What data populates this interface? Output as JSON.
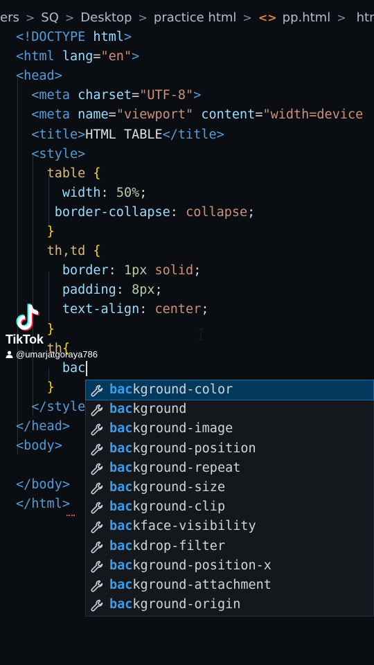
{
  "breadcrumb": {
    "items": [
      "ers",
      "SQ",
      "Desktop",
      "practice html",
      "pp.html",
      "html"
    ],
    "separator": ">"
  },
  "code_lines": [
    [
      {
        "t": "<!DOCTYPE ",
        "c": "tag"
      },
      {
        "t": "html",
        "c": "attr"
      },
      {
        "t": ">",
        "c": "tag"
      }
    ],
    [
      {
        "t": "<html ",
        "c": "tag"
      },
      {
        "t": "lang",
        "c": "attr"
      },
      {
        "t": "=",
        "c": "plain"
      },
      {
        "t": "\"en\"",
        "c": "str"
      },
      {
        "t": ">",
        "c": "tag"
      }
    ],
    [
      {
        "t": "<head>",
        "c": "tag"
      }
    ],
    [
      {
        "t": "  "
      },
      {
        "t": "<meta ",
        "c": "tag"
      },
      {
        "t": "charset",
        "c": "attr"
      },
      {
        "t": "=",
        "c": "plain"
      },
      {
        "t": "\"UTF-8\"",
        "c": "str"
      },
      {
        "t": ">",
        "c": "tag"
      }
    ],
    [
      {
        "t": "  "
      },
      {
        "t": "<meta ",
        "c": "tag"
      },
      {
        "t": "name",
        "c": "attr"
      },
      {
        "t": "=",
        "c": "plain"
      },
      {
        "t": "\"viewport\"",
        "c": "str"
      },
      {
        "t": " content",
        "c": "attr"
      },
      {
        "t": "=",
        "c": "plain"
      },
      {
        "t": "\"width=device",
        "c": "str"
      }
    ],
    [
      {
        "t": "  "
      },
      {
        "t": "<title>",
        "c": "tag"
      },
      {
        "t": "HTML TABLE",
        "c": "txt"
      },
      {
        "t": "</title>",
        "c": "tag"
      }
    ],
    [
      {
        "t": "  "
      },
      {
        "t": "<style>",
        "c": "tag"
      }
    ],
    [
      {
        "t": "    "
      },
      {
        "t": "table ",
        "c": "sel"
      },
      {
        "t": "{",
        "c": "brace"
      }
    ],
    [
      {
        "t": "      "
      },
      {
        "t": "width",
        "c": "prop"
      },
      {
        "t": ": ",
        "c": "plain"
      },
      {
        "t": "50%",
        "c": "num"
      },
      {
        "t": ";",
        "c": "plain"
      }
    ],
    [
      {
        "t": "     "
      },
      {
        "t": "border-collapse",
        "c": "prop"
      },
      {
        "t": ": ",
        "c": "plain"
      },
      {
        "t": "collapse",
        "c": "val"
      },
      {
        "t": ";",
        "c": "plain"
      }
    ],
    [
      {
        "t": "    "
      },
      {
        "t": "}",
        "c": "brace"
      }
    ],
    [
      {
        "t": "    "
      },
      {
        "t": "th,td ",
        "c": "sel"
      },
      {
        "t": "{",
        "c": "brace"
      }
    ],
    [
      {
        "t": "      "
      },
      {
        "t": "border",
        "c": "prop"
      },
      {
        "t": ": ",
        "c": "plain"
      },
      {
        "t": "1px",
        "c": "num"
      },
      {
        "t": " solid",
        "c": "val"
      },
      {
        "t": ";",
        "c": "plain"
      }
    ],
    [
      {
        "t": "      "
      },
      {
        "t": "padding",
        "c": "prop"
      },
      {
        "t": ": ",
        "c": "plain"
      },
      {
        "t": "8px",
        "c": "num"
      },
      {
        "t": ";",
        "c": "plain"
      }
    ],
    [
      {
        "t": "      "
      },
      {
        "t": "text-align",
        "c": "prop"
      },
      {
        "t": ": ",
        "c": "plain"
      },
      {
        "t": "center",
        "c": "val"
      },
      {
        "t": ";",
        "c": "plain"
      }
    ],
    [
      {
        "t": "    "
      },
      {
        "t": "}",
        "c": "brace"
      }
    ],
    [
      {
        "t": "    "
      },
      {
        "t": "th",
        "c": "sel"
      },
      {
        "t": "{",
        "c": "brace"
      }
    ],
    [
      {
        "t": "      "
      },
      {
        "t": "bac",
        "c": "prop"
      }
    ],
    [
      {
        "t": "    "
      },
      {
        "t": "}",
        "c": "brace"
      }
    ],
    [
      {
        "t": "  "
      },
      {
        "t": "</style>",
        "c": "tag"
      }
    ],
    [
      {
        "t": "</head>",
        "c": "tag"
      }
    ],
    [
      {
        "t": "<body>",
        "c": "tag"
      }
    ],
    [
      {
        "t": ""
      }
    ],
    [
      {
        "t": "</body>",
        "c": "tag"
      }
    ],
    [
      {
        "t": "</html>",
        "c": "tag"
      }
    ]
  ],
  "autocomplete": {
    "typed": "bac",
    "items": [
      {
        "match": "bac",
        "rest": "kground-color"
      },
      {
        "match": "bac",
        "rest": "kground"
      },
      {
        "match": "bac",
        "rest": "kground-image"
      },
      {
        "match": "bac",
        "rest": "kground-position"
      },
      {
        "match": "bac",
        "rest": "kground-repeat"
      },
      {
        "match": "bac",
        "rest": "kground-size"
      },
      {
        "match": "bac",
        "rest": "kground-clip"
      },
      {
        "match": "bac",
        "rest": "kface-visibility"
      },
      {
        "match": "bac",
        "rest": "kdrop-filter"
      },
      {
        "match": "bac",
        "rest": "kground-position-x"
      },
      {
        "match": "bac",
        "rest": "kground-attachment"
      },
      {
        "match": "bac",
        "rest": "kground-origin"
      }
    ],
    "selected_index": 0
  },
  "watermark": {
    "brand": "TikTok",
    "username": "@umarjatgoraya786"
  },
  "colors": {
    "background": "#0a0d12",
    "tag": "#569cd6",
    "attribute": "#9cdcfe",
    "string": "#ce9178",
    "selector": "#d7ba7d",
    "number": "#b5cea8",
    "brace": "#ffd700",
    "suggest_match": "#3b9de8",
    "suggest_active_bg": "#04395e"
  }
}
